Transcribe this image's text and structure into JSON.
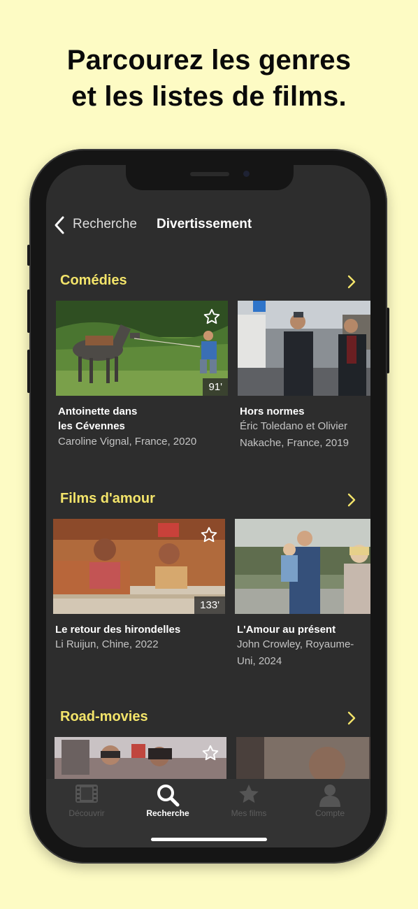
{
  "headline": {
    "line1": "Parcourez les genres",
    "line2": "et les listes de films."
  },
  "nav": {
    "back_label": "Recherche",
    "title": "Divertissement"
  },
  "sections": [
    {
      "title": "Comédies",
      "films": [
        {
          "title": "Antoinette dans les Cévennes",
          "title_line1": "Antoinette dans",
          "title_line2": "les Cévennes",
          "meta": "Caroline Vignal, France, 2020",
          "duration": "91'"
        },
        {
          "title": "Hors normes",
          "meta_line1": "Éric Toledano et Olivier",
          "meta_line2": "Nakache, France, 2019"
        }
      ]
    },
    {
      "title": "Films d'amour",
      "films": [
        {
          "title": "Le retour des hirondelles",
          "meta": "Li Ruijun, Chine, 2022",
          "duration": "133'"
        },
        {
          "title": "L'Amour au présent",
          "meta_line1": "John Crowley, Royaume-",
          "meta_line2": "Uni, 2024"
        }
      ]
    },
    {
      "title": "Road-movies",
      "films": []
    }
  ],
  "tabs": [
    {
      "label": "Découvrir",
      "icon": "film-icon",
      "active": false
    },
    {
      "label": "Recherche",
      "icon": "search-icon",
      "active": true
    },
    {
      "label": "Mes films",
      "icon": "star-icon",
      "active": false
    },
    {
      "label": "Compte",
      "icon": "user-icon",
      "active": false
    }
  ],
  "colors": {
    "background": "#fdfbc4",
    "screen": "#2d2d2d",
    "accent": "#f3e46a",
    "tab_bar": "#333333"
  }
}
